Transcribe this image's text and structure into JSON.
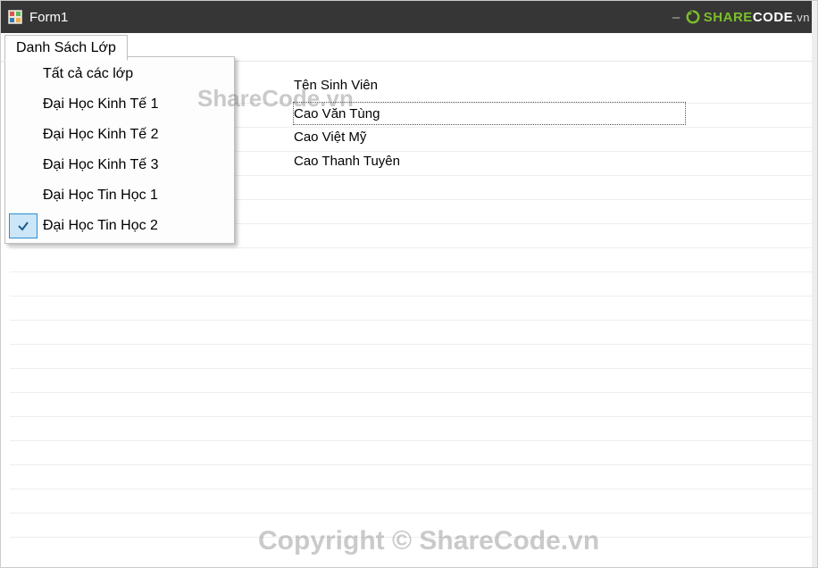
{
  "window": {
    "title": "Form1"
  },
  "brand": {
    "prefix": "SHARE",
    "suffix": "CODE",
    "tld": ".vn"
  },
  "menustrip": {
    "items": [
      {
        "label": "Danh Sách Lớp",
        "open": true
      }
    ]
  },
  "dropdown": {
    "items": [
      {
        "label": "Tất cả các lớp",
        "selected": false
      },
      {
        "label": "Đại Học Kinh Tế 1",
        "selected": false
      },
      {
        "label": "Đại Học Kinh Tế 2",
        "selected": false
      },
      {
        "label": "Đại Học Kinh Tế 3",
        "selected": false
      },
      {
        "label": "Đại Học Tin Học 1",
        "selected": false
      },
      {
        "label": "Đại Học Tin Học 2",
        "selected": true
      }
    ]
  },
  "list": {
    "header": "Tên Sinh Viên",
    "rows": [
      {
        "name": "Cao Văn Tùng",
        "focused": true
      },
      {
        "name": "Cao Việt Mỹ",
        "focused": false
      },
      {
        "name": "Cao Thanh Tuyên",
        "focused": false
      }
    ]
  },
  "watermarks": {
    "small": "ShareCode.vn",
    "big": "Copyright © ShareCode.vn"
  }
}
